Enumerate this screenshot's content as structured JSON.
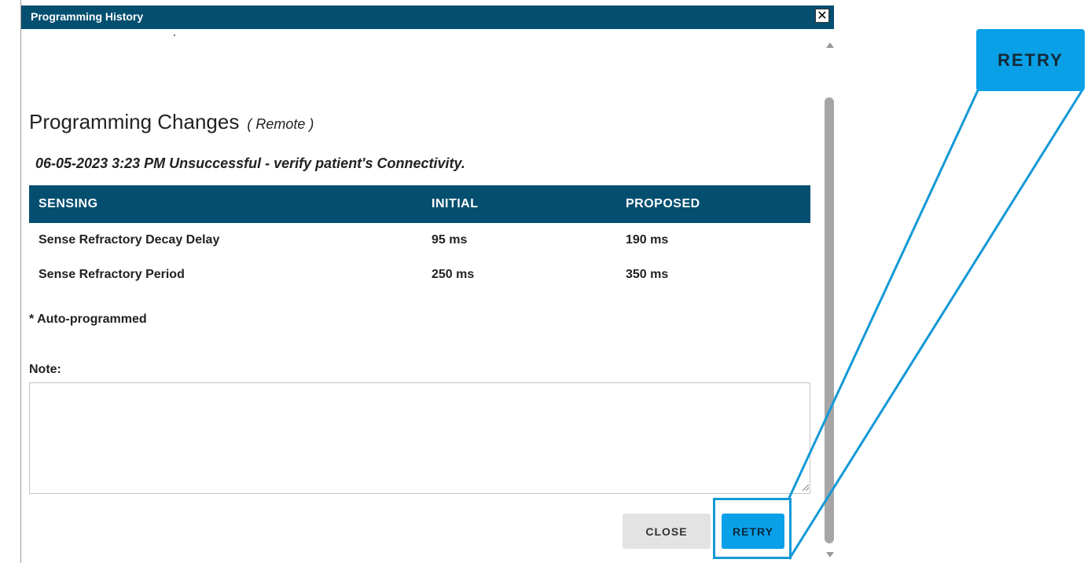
{
  "window": {
    "title": "Programming History",
    "close_icon": "close-icon"
  },
  "content": {
    "heading": "Programming Changes",
    "heading_sub": "( Remote )",
    "status": "06-05-2023 3:23 PM Unsuccessful - verify patient's Connectivity."
  },
  "table": {
    "headers": [
      "SENSING",
      "INITIAL",
      "PROPOSED"
    ],
    "rows": [
      [
        "Sense Refractory Decay Delay",
        "95 ms",
        "190 ms"
      ],
      [
        "Sense Refractory Period",
        "250 ms",
        "350 ms"
      ]
    ]
  },
  "footnote": "* Auto-programmed",
  "note": {
    "label": "Note:",
    "value": ""
  },
  "buttons": {
    "close": "CLOSE",
    "retry": "RETRY"
  },
  "callout": {
    "label": "RETRY"
  },
  "colors": {
    "header": "#044f70",
    "accent": "#0aa0e8",
    "highlight_border": "#1499d6"
  }
}
